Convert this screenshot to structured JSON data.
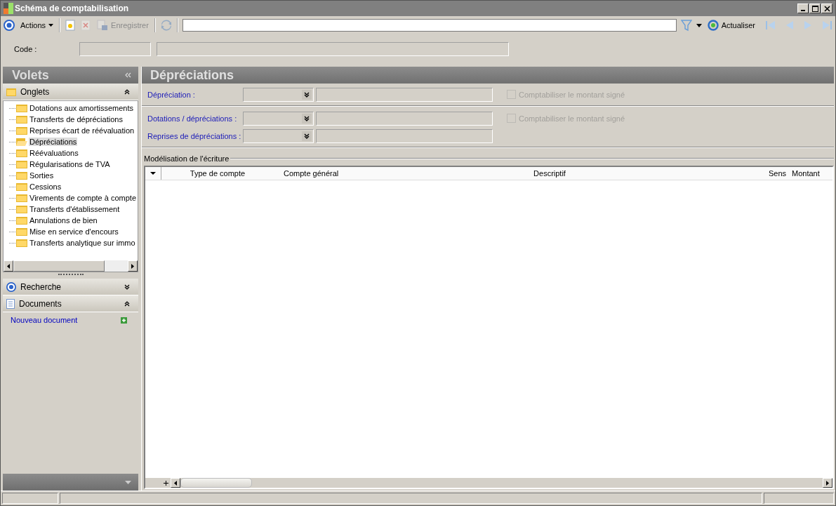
{
  "window": {
    "title": "Schéma de comptabilisation"
  },
  "toolbar": {
    "actions": "Actions",
    "save": {
      "label": "Enregistrer",
      "disabled": true
    },
    "delete": {
      "disabled": true
    },
    "refresh": "Actualiser"
  },
  "code": {
    "label": "Code :"
  },
  "volets": {
    "title": "Volets",
    "onglets": {
      "title": "Onglets",
      "expanded": true,
      "items": [
        {
          "label": "Dotations aux amortissements",
          "selected": false
        },
        {
          "label": "Transferts de dépréciations",
          "selected": false
        },
        {
          "label": "Reprises écart de réévaluation",
          "selected": false
        },
        {
          "label": "Dépréciations",
          "selected": true
        },
        {
          "label": "Réévaluations",
          "selected": false
        },
        {
          "label": "Régularisations de TVA",
          "selected": false
        },
        {
          "label": "Sorties",
          "selected": false
        },
        {
          "label": "Cessions",
          "selected": false
        },
        {
          "label": "Virements de compte à compte",
          "selected": false
        },
        {
          "label": "Transferts d'établissement",
          "selected": false
        },
        {
          "label": "Annulations de bien",
          "selected": false
        },
        {
          "label": "Mise en service d'encours",
          "selected": false
        },
        {
          "label": "Transferts analytique sur immo",
          "selected": false
        }
      ]
    },
    "recherche": {
      "title": "Recherche",
      "expanded": false
    },
    "documents": {
      "title": "Documents",
      "expanded": true,
      "link": "Nouveau document"
    }
  },
  "panel": {
    "title": "Dépréciations",
    "groups": [
      [
        {
          "label": "Dépréciation :",
          "checkbox": {
            "label": "Comptabiliser le montant signé",
            "checked": false,
            "disabled": true
          }
        }
      ],
      [
        {
          "label": "Dotations / dépréciations :",
          "checkbox": {
            "label": "Comptabiliser le montant signé",
            "checked": false,
            "disabled": true
          }
        },
        {
          "label": "Reprises de dépréciations :"
        }
      ]
    ],
    "grid": {
      "title": "Modélisation de l'écriture",
      "columns": [
        "Type de compte",
        "Compte général",
        "Descriptif",
        "Sens",
        "Montant"
      ]
    }
  }
}
